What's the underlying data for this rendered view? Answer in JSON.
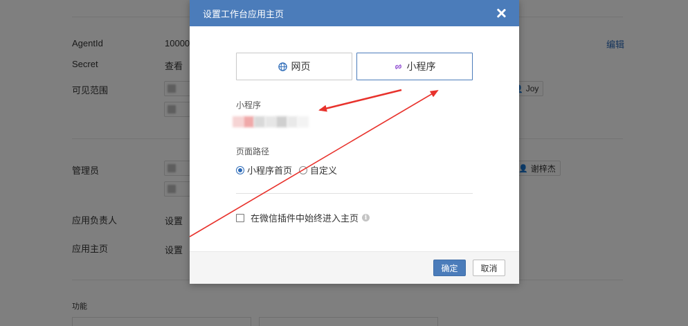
{
  "background": {
    "agentid_label": "AgentId",
    "agentid_value": "10000",
    "secret_label": "Secret",
    "secret_value": "查看",
    "visible_label": "可见范围",
    "edit_label": "编辑",
    "visible_chip_person": "Joy",
    "admin_label": "管理员",
    "admin_chip_person": "谢梓杰",
    "owner_label": "应用负责人",
    "owner_value": "设置",
    "homepage_label": "应用主页",
    "homepage_value": "设置",
    "features_label": "功能"
  },
  "modal": {
    "title": "设置工作台应用主页",
    "tabs": [
      {
        "label": "网页",
        "icon": "globe-icon"
      },
      {
        "label": "小程序",
        "icon": "link-icon"
      }
    ],
    "selected_tab": "小程序",
    "miniprogram_label": "小程序",
    "path_label": "页面路径",
    "radio_options": [
      "小程序首页",
      "自定义"
    ],
    "radio_selected": "小程序首页",
    "checkbox_label": "在微信插件中始终进入主页",
    "checkbox_checked": false,
    "ok_label": "确定",
    "cancel_label": "取消"
  },
  "colors": {
    "header": "#4b7cba",
    "annotation_arrow": "#e8322c",
    "link": "#2d6bb8"
  }
}
